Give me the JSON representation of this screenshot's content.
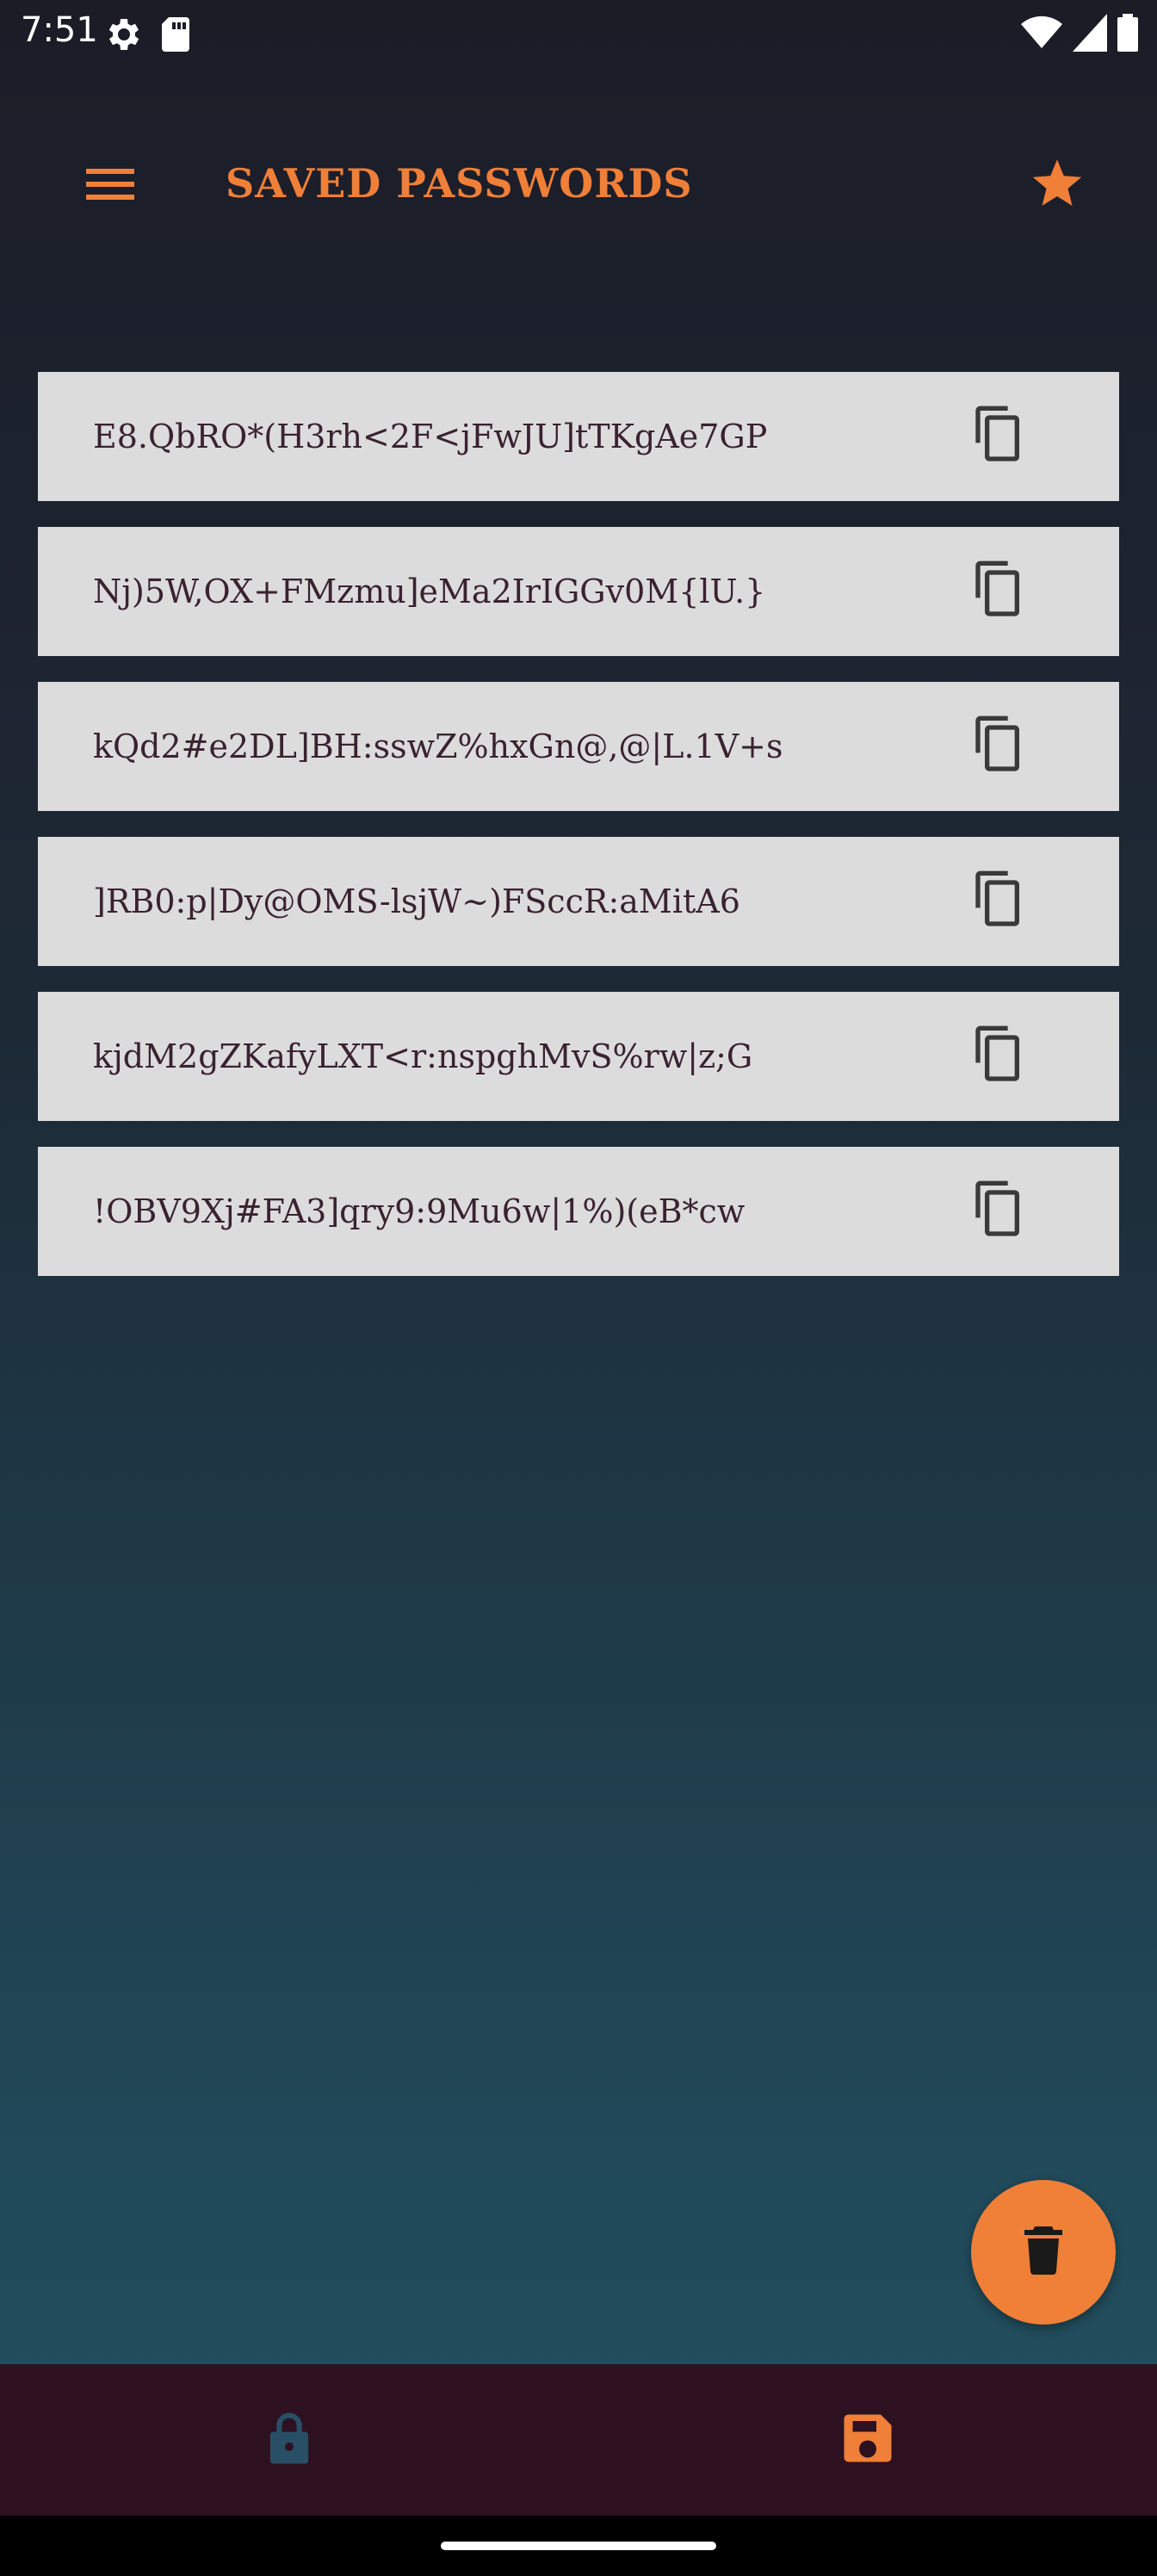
{
  "status_bar": {
    "time": "7:51",
    "left_icons": [
      "settings-gear-icon",
      "sd-card-icon"
    ],
    "right_icons": [
      "wifi-icon",
      "cell-signal-icon",
      "battery-icon"
    ]
  },
  "app_bar": {
    "title": "SAVED PASSWORDS",
    "menu_icon": "hamburger-menu-icon",
    "action_icon": "star-icon"
  },
  "passwords": [
    "E8.QbRO*(H3rh<2F<jFwJU]tTKgAe7GP",
    "Nj)5W,OX+FMzmu]eMa2IrIGGv0M{lU.}",
    "kQd2#e2DL]BH:sswZ%hxGn@,@|L.1V+s",
    "]RB0:p|Dy@OMS-lsjW~)FSccR:aMitA6",
    "kjdM2gZKafyLXT<r:nspghMvS%rw|z;G",
    "!OBV9Xj#FA3]qry9:9Mu6w|1%)(eB*cw"
  ],
  "fab": {
    "icon": "trash-icon"
  },
  "bottom_nav": {
    "items": [
      {
        "icon": "lock-icon",
        "active": false
      },
      {
        "icon": "save-icon",
        "active": true
      }
    ]
  },
  "colors": {
    "accent": "#f07f38",
    "row_background": "#dcdcdc",
    "row_text": "#3a2230",
    "nav_background": "#2e1120",
    "inactive_nav_icon": "#284f66"
  }
}
